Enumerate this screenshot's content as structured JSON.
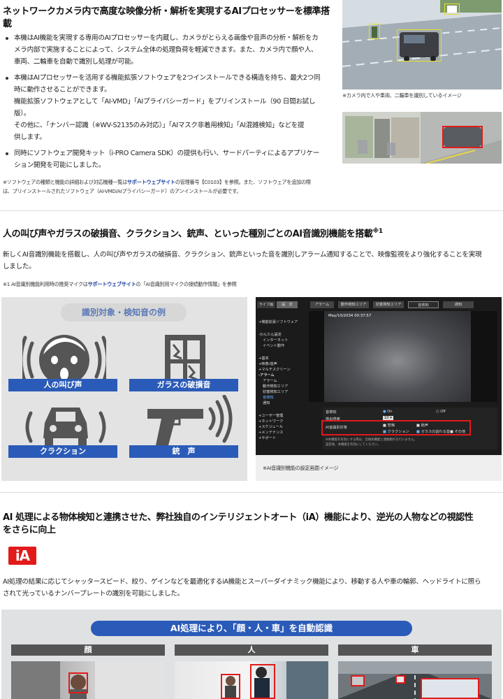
{
  "section1": {
    "heading": "ネットワークカメラ内で高度な映像分析・解析を実現するAIプロセッサーを標準搭載",
    "bullets": [
      {
        "lines": [
          "本機はAI機能を実現する専用のAIプロセッサーを内蔵し、カメラがとらえる画像や音声の分析・解析をカ",
          "メラ内部で実施することによって、システム全体の処理負荷を軽減できます。また、カメラ内で顔や人、",
          "車両、二輪車を自動で識別し処理が可能。"
        ]
      },
      {
        "lines": [
          "本機はAIプロセッサーを活用する機能拡張ソフトウェアを2つインストールできる構造を持ち、最大2つ同",
          "時に動作させることができます。",
          "機能拡張ソフトウェアとして「AI-VMD」「AIプライバシーガード」をプリインストール（90 日間お試し",
          "版）。",
          "その他に、「ナンバー認識（※WV-S2135のみ対応）」「AIマスク非着用検知」「AI混雑検知」などを提",
          "供します。"
        ]
      },
      {
        "lines": [
          "同時にソフトウェア開発キット（i-PRO Camera SDK）の提供も行い、サードパーティによるアプリケー",
          "ション開発を可能にしました。"
        ]
      }
    ],
    "note_line1_pre": "※ソフトウェアの種類と機能の詳細および対応機種一覧は",
    "note_link": "サポートウェブサイト",
    "note_line1_post": "の管理番号【C0103】を参照。また、ソフトウェアを追加の際",
    "note_line2": "は、プリインストールされたソフトウェア（AI-VMD/AIプライバシーガード）のアンインストールが必要です。",
    "photo_caption": "※カメラ内で人や車両、二輪車を識別しているイメージ"
  },
  "section2": {
    "heading": "人の叫び声やガラスの破損音、クラクション、銃声、といった種別ごとのAI音識別機能を搭載",
    "heading_sup": "※1",
    "para_line1": "新しくAI音識別機能を搭載し、人の叫び声やガラスの破損音、クラクション、銃声といった音を識別しアラーム通知することで、映像監視をより強化することを実現",
    "para_line2": "しました。",
    "note_pre": "※1 AI音識別機能利用時の推奨マイクは",
    "note_link": "サポートウェブサイト",
    "note_post": "の「AI音識別用マイクの接続動作情報」を参照",
    "panel_title": "識別対象・検知音の例",
    "labels": [
      "人の叫び声",
      "ガラスの破損音",
      "クラクション",
      "銃　声"
    ],
    "screenshot_caption": "※AI音識別機能の設定画面イメージ",
    "screen": {
      "top_tabs": [
        "ライブ画",
        "設　定"
      ],
      "tabs": [
        "アラーム",
        "動作検知エリア",
        "妨害検知エリア",
        "音検知",
        "通知"
      ],
      "timestamp": "May/10/2034  00:37:57",
      "menu": [
        "+機能拡張ソフトウェア",
        "-かんたん設定",
        "インターネット",
        "イベント動作",
        "+基本",
        "+映像/音声",
        "+マルチスクリーン",
        "-アラーム",
        "アラーム",
        "動作検知エリア",
        "妨害検知エリア",
        "音検知",
        "通知",
        "+ユーザー管理",
        "+ネットワーク",
        "+スケジュール",
        "+メンテナンス",
        "+サポート"
      ],
      "row_sound": "音検知",
      "opt_on": "On",
      "opt_off": "Off",
      "row_sensitivity": "検出感度",
      "sensitivity_value": "10",
      "row_ai": "AI音識別対象",
      "checks": [
        "悲鳴",
        "銃声",
        "クラクション",
        "ガラスの割れる音",
        "その他"
      ],
      "footer": "※本機能を有効にする際は、音検知機能と連動動作を行いません。",
      "footer2": "設定後、本機能を有効にしてください。"
    }
  },
  "section3": {
    "heading_line1": "AI 処理による物体検知と連携させた、弊社独自のインテリジェントオート（iA）機能により、逆光の人物などの視認性",
    "heading_line2": "をさらに向上",
    "logo_text": "iA",
    "para_line1": "AI処理の結果に応じてシャッタースピード、絞り、ゲインなどを最適化するiA機能とスーパーダイナミック機能により、移動する人や車の輪郭、ヘッドライトに照ら",
    "para_line2": "されて光っているナンバープレートの識別を可能にしました。",
    "banner": "AI処理により、「顔・人・車」を自動認識",
    "columns": [
      "顔",
      "人",
      "車"
    ]
  },
  "colors": {
    "accent_blue": "#2b5bb8",
    "alert_red": "#e21a1a",
    "link_blue": "#1a3fa0"
  }
}
